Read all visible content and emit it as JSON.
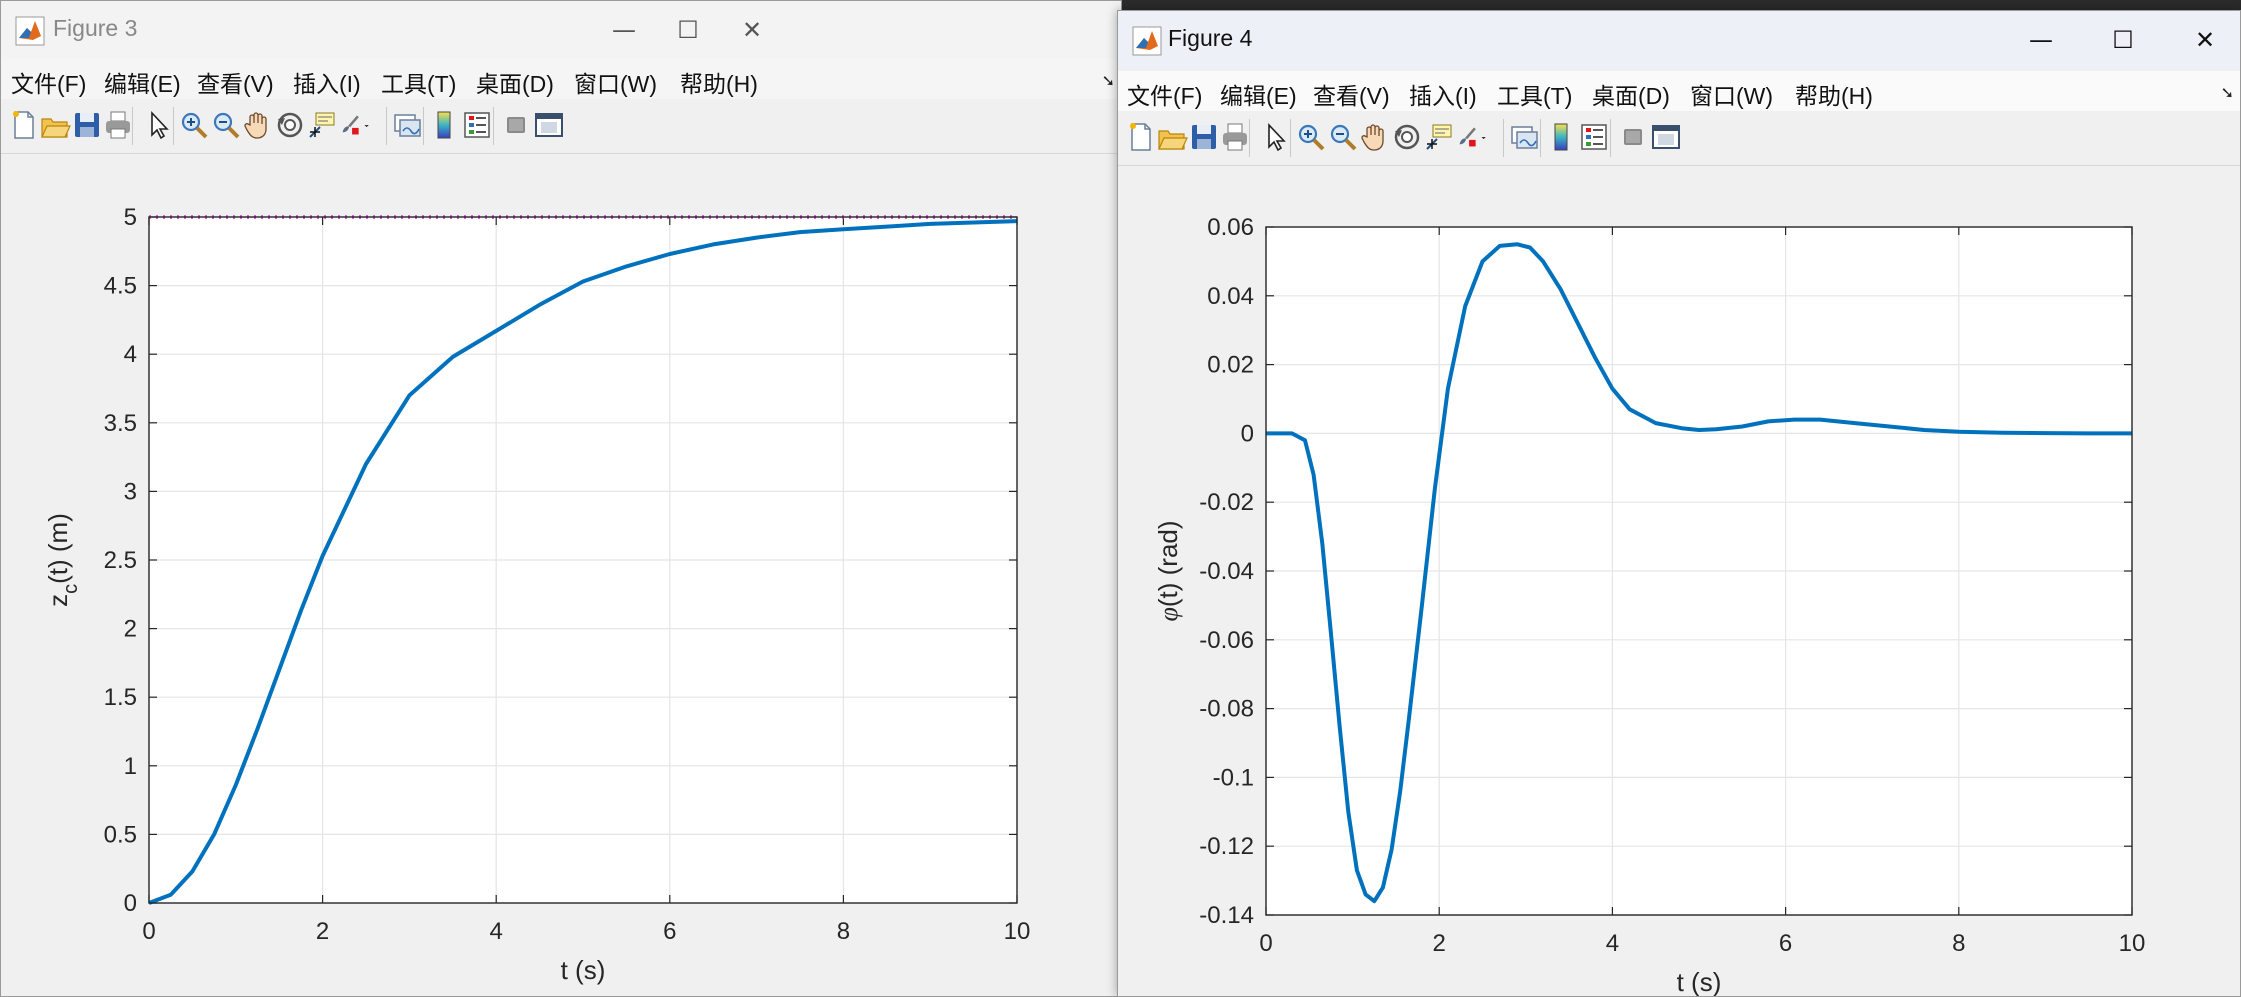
{
  "windows": [
    {
      "id": "fig3",
      "title": "Figure 3",
      "menu": [
        "文件(F)",
        "编辑(E)",
        "查看(V)",
        "插入(I)",
        "工具(T)",
        "桌面(D)",
        "窗口(W)",
        "帮助(H)"
      ],
      "controls": {
        "minimize": "—",
        "maximize": "☐",
        "close": "✕"
      }
    },
    {
      "id": "fig4",
      "title": "Figure 4",
      "menu": [
        "文件(F)",
        "编辑(E)",
        "查看(V)",
        "插入(I)",
        "工具(T)",
        "桌面(D)",
        "窗口(W)",
        "帮助(H)"
      ],
      "controls": {
        "minimize": "—",
        "maximize": "☐",
        "close": "✕"
      }
    }
  ],
  "toolbar_icons": [
    "new-figure-icon",
    "open-file-icon",
    "save-icon",
    "print-icon",
    "pointer-icon",
    "zoom-in-icon",
    "zoom-out-icon",
    "pan-hand-icon",
    "rotate-3d-icon",
    "data-cursor-icon",
    "brush-icon",
    "link-plot-icon",
    "colorbar-icon",
    "legend-icon",
    "hide-plot-tools-icon",
    "show-plot-tools-icon"
  ],
  "colors": {
    "line": "#0072BD",
    "reference": "#D62FD6",
    "grid": "#e5e5e5"
  },
  "chart_data": [
    {
      "type": "line",
      "xlabel": "t (s)",
      "ylabel": "z_c(t) (m)",
      "xlim": [
        0,
        10
      ],
      "ylim": [
        0,
        5
      ],
      "xticks": [
        "0",
        "2",
        "4",
        "6",
        "8",
        "10"
      ],
      "yticks": [
        "0",
        "0.5",
        "1",
        "1.5",
        "2",
        "2.5",
        "3",
        "3.5",
        "4",
        "4.5",
        "5"
      ],
      "grid": true,
      "series": [
        {
          "x": [
            0,
            0.25,
            0.5,
            0.75,
            1,
            1.25,
            1.5,
            1.75,
            2,
            2.5,
            3,
            3.5,
            4,
            4.5,
            5,
            5.5,
            6,
            6.5,
            7,
            7.5,
            8,
            8.5,
            9,
            9.5,
            10
          ],
          "y": [
            0,
            0.06,
            0.23,
            0.5,
            0.86,
            1.27,
            1.7,
            2.13,
            2.53,
            3.2,
            3.7,
            3.98,
            4.17,
            4.36,
            4.53,
            4.64,
            4.73,
            4.8,
            4.85,
            4.89,
            4.91,
            4.93,
            4.95,
            4.96,
            4.97
          ]
        },
        {
          "x": [
            0,
            10
          ],
          "y": [
            5,
            5
          ],
          "style": "dotted"
        }
      ]
    },
    {
      "type": "line",
      "xlabel": "t (s)",
      "ylabel": "φ(t) (rad)",
      "xlim": [
        0,
        10
      ],
      "ylim": [
        -0.14,
        0.06
      ],
      "xticks": [
        "0",
        "2",
        "4",
        "6",
        "8",
        "10"
      ],
      "yticks": [
        "-0.14",
        "-0.12",
        "-0.1",
        "-0.08",
        "-0.06",
        "-0.04",
        "-0.02",
        "0",
        "0.02",
        "0.04",
        "0.06"
      ],
      "grid": true,
      "series": [
        {
          "x": [
            0,
            0.3,
            0.45,
            0.55,
            0.65,
            0.75,
            0.85,
            0.95,
            1.05,
            1.15,
            1.25,
            1.35,
            1.45,
            1.55,
            1.65,
            1.8,
            1.95,
            2.1,
            2.3,
            2.5,
            2.7,
            2.9,
            3.05,
            3.2,
            3.4,
            3.6,
            3.8,
            4.0,
            4.2,
            4.5,
            4.8,
            5.0,
            5.2,
            5.5,
            5.8,
            6.1,
            6.4,
            6.8,
            7.2,
            7.6,
            8.0,
            8.5,
            9.0,
            9.5,
            10
          ],
          "y": [
            0,
            0,
            -0.002,
            -0.012,
            -0.032,
            -0.058,
            -0.085,
            -0.11,
            -0.127,
            -0.134,
            -0.136,
            -0.132,
            -0.121,
            -0.104,
            -0.083,
            -0.05,
            -0.016,
            0.013,
            0.037,
            0.05,
            0.0545,
            0.055,
            0.054,
            0.05,
            0.042,
            0.032,
            0.022,
            0.013,
            0.007,
            0.003,
            0.0015,
            0.001,
            0.0012,
            0.002,
            0.0035,
            0.004,
            0.004,
            0.003,
            0.002,
            0.001,
            0.0005,
            0.0002,
            0.0001,
            0,
            0
          ]
        }
      ]
    }
  ]
}
